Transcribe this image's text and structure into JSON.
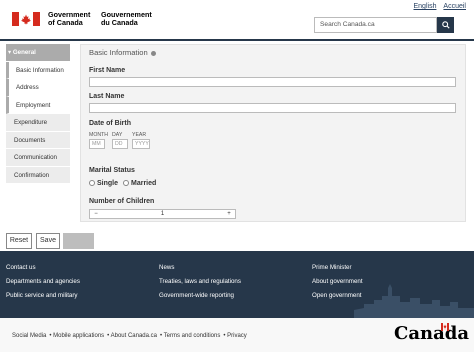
{
  "header": {
    "gov_en_line1": "Government",
    "gov_en_line2": "of Canada",
    "gov_fr_line1": "Gouvernement",
    "gov_fr_line2": "du Canada",
    "lang_english": "English",
    "lang_french": "Accueil",
    "search_placeholder": "Search Canada.ca",
    "brand_color": "#26374a",
    "flag_color": "#d52b1e"
  },
  "sidebar": {
    "items": [
      {
        "label": "General",
        "active": true
      },
      {
        "label": "Basic Information",
        "sub": true
      },
      {
        "label": "Address",
        "sub": true
      },
      {
        "label": "Employment",
        "sub": true
      },
      {
        "label": "Expenditure"
      },
      {
        "label": "Documents"
      },
      {
        "label": "Communication"
      },
      {
        "label": "Confirmation"
      }
    ]
  },
  "form": {
    "section_title": "Basic Information",
    "first_name_label": "First Name",
    "last_name_label": "Last Name",
    "dob_label": "Date of Birth",
    "month_label": "MONTH",
    "day_label": "DAY",
    "year_label": "YEAR",
    "month_placeholder": "MM",
    "day_placeholder": "DD",
    "year_placeholder": "YYYY",
    "marital_label": "Marital Status",
    "single_label": "Single",
    "married_label": "Married",
    "children_label": "Number of Children",
    "children_value": "1",
    "minus": "−",
    "plus": "+"
  },
  "actions": {
    "reset": "Reset",
    "save": "Save",
    "next": ""
  },
  "footer": {
    "col1": [
      "Contact us",
      "Departments and agencies",
      "Public service and military"
    ],
    "col2": [
      "News",
      "Treaties, laws and regulations",
      "Government-wide reporting"
    ],
    "col3": [
      "Prime Minister",
      "About government",
      "Open government"
    ],
    "sub": [
      "Social Media",
      "Mobile applications",
      "About Canada.ca",
      "Terms and conditions",
      "Privacy"
    ],
    "wordmark": "Canada"
  }
}
